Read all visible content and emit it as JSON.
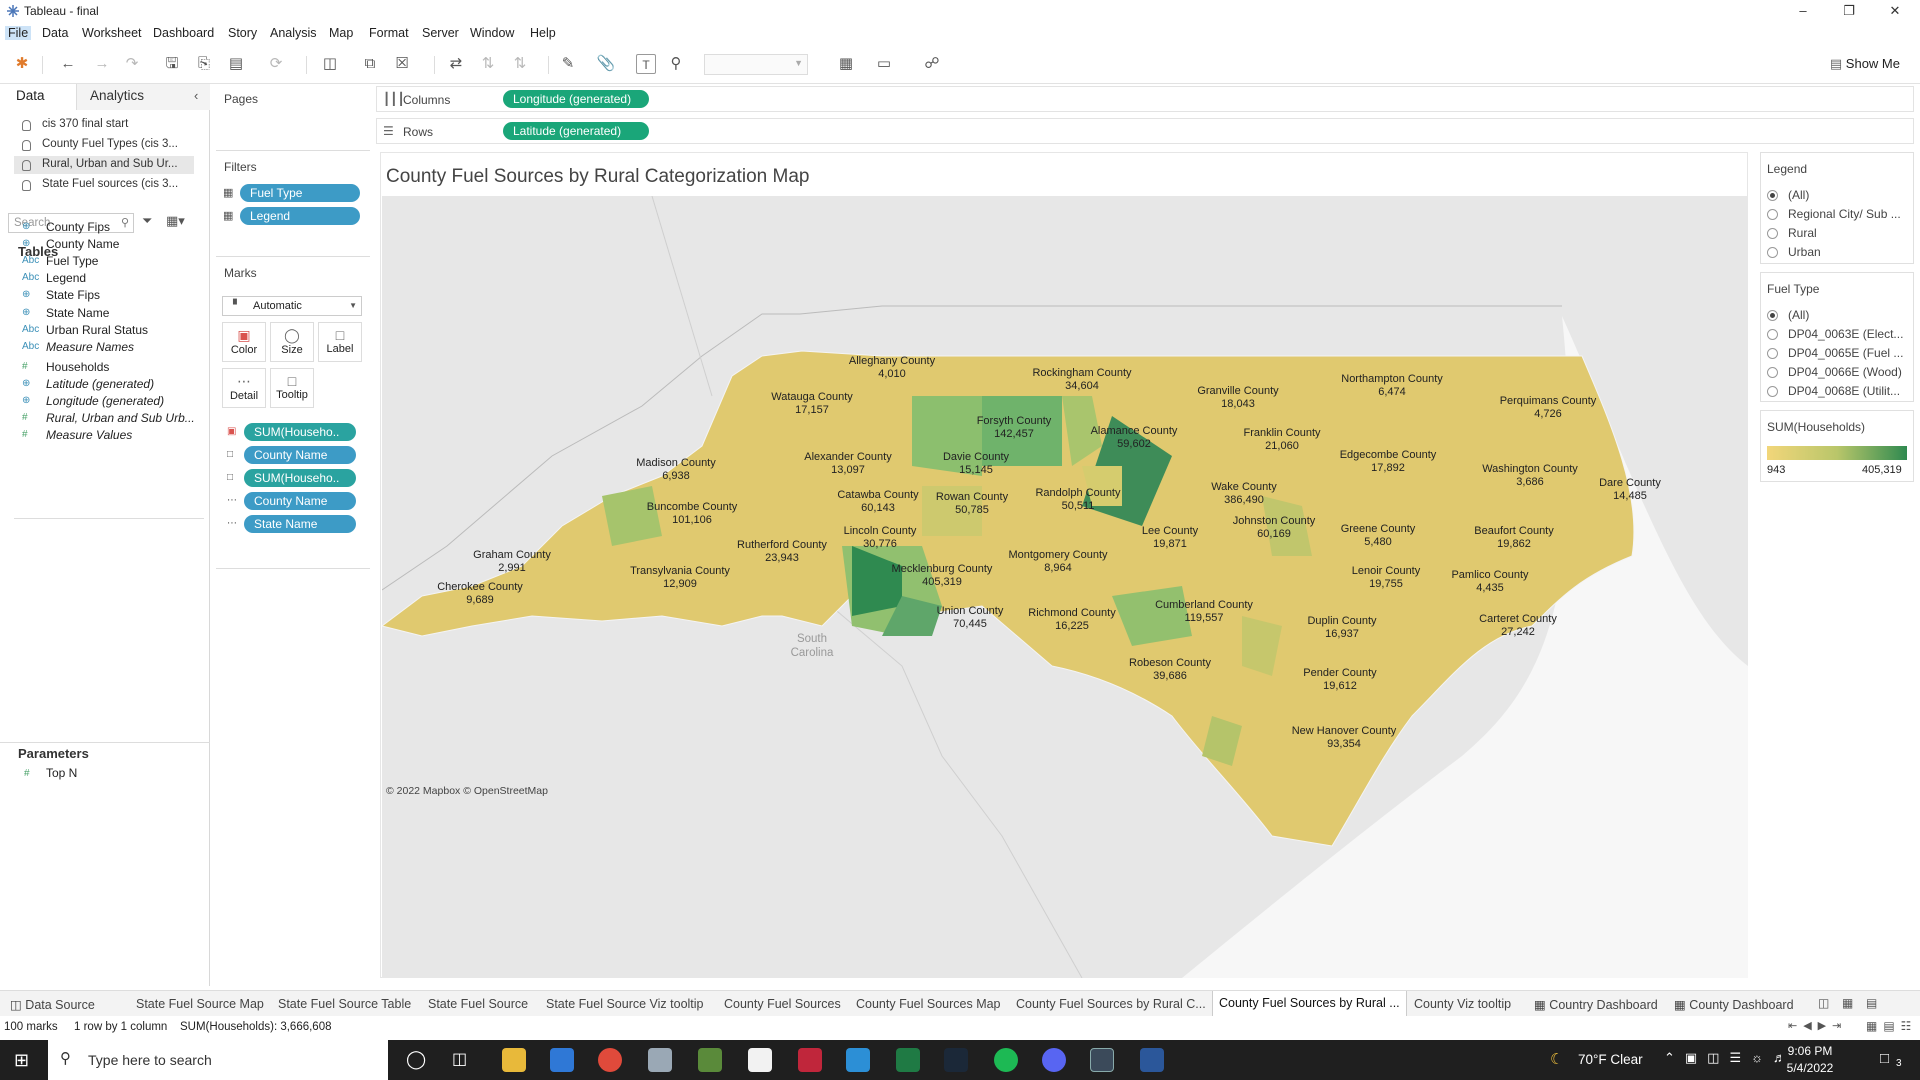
{
  "window": {
    "title": "Tableau - final"
  },
  "menu": [
    "File",
    "Data",
    "Worksheet",
    "Dashboard",
    "Story",
    "Analysis",
    "Map",
    "Format",
    "Server",
    "Window",
    "Help"
  ],
  "toolbar": {
    "show_me": "Show Me"
  },
  "data_pane": {
    "tabs": [
      "Data",
      "Analytics"
    ],
    "sources": [
      "cis 370 final start",
      "County Fuel Types (cis 3...",
      "Rural, Urban and Sub Ur...",
      "State Fuel sources (cis 3..."
    ],
    "search_placeholder": "Search",
    "tables_header": "Tables",
    "fields": [
      {
        "icon": "globe",
        "label": "County Fips"
      },
      {
        "icon": "globe",
        "label": "County Name"
      },
      {
        "icon": "Abc",
        "label": "Fuel Type"
      },
      {
        "icon": "Abc",
        "label": "Legend"
      },
      {
        "icon": "globe",
        "label": "State Fips"
      },
      {
        "icon": "globe",
        "label": "State Name"
      },
      {
        "icon": "Abc",
        "label": "Urban Rural Status"
      },
      {
        "icon": "Abc",
        "label": "Measure Names"
      },
      {
        "icon": "#",
        "label": "Households"
      },
      {
        "icon": "globe",
        "label": "Latitude (generated)"
      },
      {
        "icon": "globe",
        "label": "Longitude (generated)"
      },
      {
        "icon": "#",
        "label": "Rural, Urban and Sub Urb..."
      },
      {
        "icon": "#",
        "label": "Measure Values"
      }
    ],
    "parameters_header": "Parameters",
    "parameters": [
      "Top N"
    ]
  },
  "shelves": {
    "pages": "Pages",
    "filters": "Filters",
    "filter_pills": [
      "Fuel Type",
      "Legend"
    ],
    "marks": "Marks",
    "mark_type": "Automatic",
    "mark_buttons": [
      "Color",
      "Size",
      "Label",
      "Detail",
      "Tooltip"
    ],
    "mark_pills": [
      "SUM(Househo..",
      "County Name",
      "SUM(Househo..",
      "County Name",
      "State Name"
    ],
    "columns_label": "Columns",
    "columns_pill": "Longitude (generated)",
    "rows_label": "Rows",
    "rows_pill": "Latitude (generated)"
  },
  "viz": {
    "title": "County Fuel Sources by Rural Categorization Map",
    "attribution": "© 2022 Mapbox © OpenStreetMap",
    "basemap_labels": [
      "South",
      "Carolina"
    ],
    "county_labels": [
      {
        "name": "Alleghany County",
        "value": "4,010"
      },
      {
        "name": "Rockingham County",
        "value": "34,604"
      },
      {
        "name": "Granville County",
        "value": "18,043"
      },
      {
        "name": "Northampton County",
        "value": "6,474"
      },
      {
        "name": "Perquimans County",
        "value": "4,726"
      },
      {
        "name": "Watauga County",
        "value": "17,157"
      },
      {
        "name": "Forsyth County",
        "value": "142,457"
      },
      {
        "name": "Alamance County",
        "value": "59,602"
      },
      {
        "name": "Franklin County",
        "value": "21,060"
      },
      {
        "name": "Edgecombe County",
        "value": "17,892"
      },
      {
        "name": "Washington County",
        "value": "3,686"
      },
      {
        "name": "Dare County",
        "value": "14,485"
      },
      {
        "name": "Madison County",
        "value": "6,938"
      },
      {
        "name": "Alexander County",
        "value": "13,097"
      },
      {
        "name": "Davie County",
        "value": "15,145"
      },
      {
        "name": "Wake County",
        "value": "386,490"
      },
      {
        "name": "Buncombe County",
        "value": "101,106"
      },
      {
        "name": "Catawba County",
        "value": "60,143"
      },
      {
        "name": "Rowan County",
        "value": "50,785"
      },
      {
        "name": "Randolph County",
        "value": "50,511"
      },
      {
        "name": "Johnston County",
        "value": "60,169"
      },
      {
        "name": "Greene County",
        "value": "5,480"
      },
      {
        "name": "Beaufort County",
        "value": "19,862"
      },
      {
        "name": "Lincoln County",
        "value": "30,776"
      },
      {
        "name": "Lee County",
        "value": "19,871"
      },
      {
        "name": "Graham County",
        "value": "2,991"
      },
      {
        "name": "Rutherford County",
        "value": "23,943"
      },
      {
        "name": "Mecklenburg County",
        "value": "405,319"
      },
      {
        "name": "Montgomery County",
        "value": "8,964"
      },
      {
        "name": "Lenoir County",
        "value": "19,755"
      },
      {
        "name": "Pamlico County",
        "value": "4,435"
      },
      {
        "name": "Transylvania County",
        "value": "12,909"
      },
      {
        "name": "Cherokee County",
        "value": "9,689"
      },
      {
        "name": "Union County",
        "value": "70,445"
      },
      {
        "name": "Richmond County",
        "value": "16,225"
      },
      {
        "name": "Cumberland County",
        "value": "119,557"
      },
      {
        "name": "Duplin County",
        "value": "16,937"
      },
      {
        "name": "Carteret County",
        "value": "27,242"
      },
      {
        "name": "Robeson County",
        "value": "39,686"
      },
      {
        "name": "Pender County",
        "value": "19,612"
      },
      {
        "name": "New Hanover County",
        "value": "93,354"
      }
    ]
  },
  "legend_card": {
    "title": "Legend",
    "options": [
      "(All)",
      "Regional City/ Sub ...",
      "Rural",
      "Urban"
    ],
    "selected": 0
  },
  "fuel_card": {
    "title": "Fuel Type",
    "options": [
      "(All)",
      "DP04_0063E (Elect...",
      "DP04_0065E (Fuel ...",
      "DP04_0066E (Wood)",
      "DP04_0068E (Utilit..."
    ],
    "selected": 0
  },
  "color_legend": {
    "title": "SUM(Households)",
    "min": "943",
    "max": "405,319",
    "colors": [
      "#f2d67a",
      "#b9c66a",
      "#2f8a50"
    ]
  },
  "sheet_tabs": {
    "first": "Data Source",
    "tabs": [
      "State Fuel Source Map",
      "State Fuel Source Table",
      "State Fuel Source",
      "State Fuel Source Viz tooltip",
      "County Fuel Sources",
      "County Fuel Sources Map",
      "County Fuel Sources by Rural C...",
      "County Fuel Sources by Rural ...",
      "County Viz tooltip",
      "Country Dashboard",
      "County Dashboard"
    ],
    "active": 7
  },
  "status": {
    "marks": "100 marks",
    "dims": "1 row by 1 column",
    "sum": "SUM(Households): 3,666,608"
  },
  "taskbar": {
    "search_placeholder": "Type here to search",
    "weather": "70°F  Clear",
    "time": "9:06 PM",
    "date": "5/4/2022",
    "notif": "3"
  }
}
